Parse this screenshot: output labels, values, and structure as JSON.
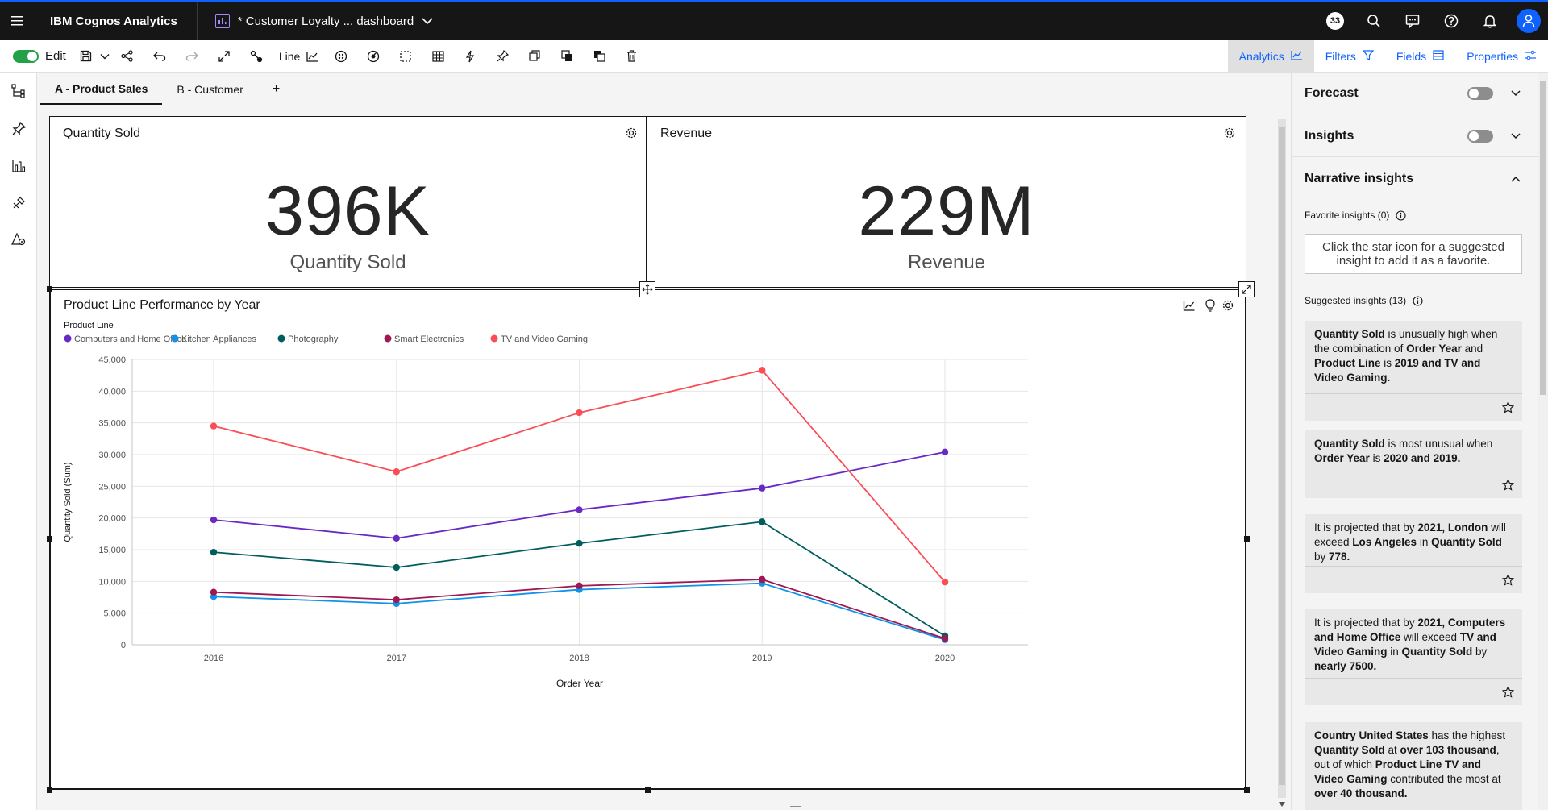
{
  "header": {
    "brand": "IBM Cognos Analytics",
    "dashboard_title": "* Customer Loyalty ... dashboard",
    "notification_count": "33",
    "icons": [
      "menu-icon",
      "dashboard-icon",
      "chevron-down-icon",
      "search-icon",
      "chat-icon",
      "help-icon",
      "notification-icon",
      "user-icon"
    ]
  },
  "toolbar": {
    "edit_label": "Edit",
    "chart_type_label": "Line",
    "tabs": [
      {
        "label": "Analytics",
        "active": true
      },
      {
        "label": "Filters",
        "active": false
      },
      {
        "label": "Fields",
        "active": false
      },
      {
        "label": "Properties",
        "active": false
      }
    ]
  },
  "page_tabs": [
    "A - Product Sales",
    "B - Customer",
    "+"
  ],
  "widgets": {
    "quantity": {
      "title": "Quantity Sold",
      "value": "396K",
      "label": "Quantity Sold"
    },
    "revenue": {
      "title": "Revenue",
      "value": "229M",
      "label": "Revenue"
    },
    "chart": {
      "title": "Product Line Performance by Year"
    }
  },
  "chart_data": {
    "type": "line",
    "title": "Product Line Performance by Year",
    "legend_title": "Product Line",
    "legend_position": "top-left",
    "xlabel": "Order Year",
    "ylabel": "Quantity Sold (Sum)",
    "x": [
      "2016",
      "2017",
      "2018",
      "2019",
      "2020"
    ],
    "ylim": [
      0,
      45000
    ],
    "yticks": [
      "0",
      "5,000",
      "10,000",
      "15,000",
      "20,000",
      "25,000",
      "30,000",
      "35,000",
      "40,000",
      "45,000"
    ],
    "grid": true,
    "series": [
      {
        "name": "Computers and Home Office",
        "color": "#6929c4",
        "values": [
          19700,
          16800,
          21300,
          24700,
          30400
        ]
      },
      {
        "name": "Kitchen Appliances",
        "color": "#1192e8",
        "values": [
          7600,
          6500,
          8700,
          9700,
          800
        ]
      },
      {
        "name": "Photography",
        "color": "#005d5d",
        "values": [
          14600,
          12200,
          16000,
          19400,
          1400
        ]
      },
      {
        "name": "Smart Electronics",
        "color": "#9f1853",
        "values": [
          8300,
          7100,
          9300,
          10300,
          1000
        ]
      },
      {
        "name": "TV and Video Gaming",
        "color": "#fa4d56",
        "values": [
          34500,
          27300,
          36600,
          43300,
          9900
        ]
      }
    ]
  },
  "right_panel": {
    "forecast": "Forecast",
    "insights": "Insights",
    "narrative": "Narrative insights",
    "favorite_label": "Favorite insights (0)",
    "favorite_empty": "Click the star icon for a suggested insight to add it as a favorite.",
    "suggested_label": "Suggested insights (13)",
    "cards": [
      [
        {
          "t": "Quantity Sold",
          "b": true
        },
        {
          "t": " is unusually high when the combination of "
        },
        {
          "t": "Order Year",
          "b": true
        },
        {
          "t": " and "
        },
        {
          "t": "Product Line",
          "b": true
        },
        {
          "t": " is "
        },
        {
          "t": "2019 and TV and Video Gaming.",
          "b": true
        }
      ],
      [
        {
          "t": "Quantity Sold",
          "b": true
        },
        {
          "t": " is most unusual when "
        },
        {
          "t": "Order Year",
          "b": true
        },
        {
          "t": " is "
        },
        {
          "t": "2020 and 2019.",
          "b": true
        }
      ],
      [
        {
          "t": "It is projected that by "
        },
        {
          "t": "2021, London",
          "b": true
        },
        {
          "t": " will exceed "
        },
        {
          "t": "Los Angeles",
          "b": true
        },
        {
          "t": " in "
        },
        {
          "t": "Quantity Sold",
          "b": true
        },
        {
          "t": " by "
        },
        {
          "t": "778.",
          "b": true
        }
      ],
      [
        {
          "t": "It is projected that by "
        },
        {
          "t": "2021, Computers and Home Office",
          "b": true
        },
        {
          "t": " will exceed "
        },
        {
          "t": "TV and Video Gaming",
          "b": true
        },
        {
          "t": " in "
        },
        {
          "t": "Quantity Sold",
          "b": true
        },
        {
          "t": " by "
        },
        {
          "t": "nearly 7500.",
          "b": true
        }
      ],
      [
        {
          "t": "Country United States",
          "b": true
        },
        {
          "t": " has the highest "
        },
        {
          "t": "Quantity Sold",
          "b": true
        },
        {
          "t": " at "
        },
        {
          "t": "over 103 thousand",
          "b": true
        },
        {
          "t": ", out of which "
        },
        {
          "t": "Product Line TV and Video Gaming",
          "b": true
        },
        {
          "t": " contributed the most at "
        },
        {
          "t": "over 40 thousand.",
          "b": true
        }
      ]
    ]
  }
}
